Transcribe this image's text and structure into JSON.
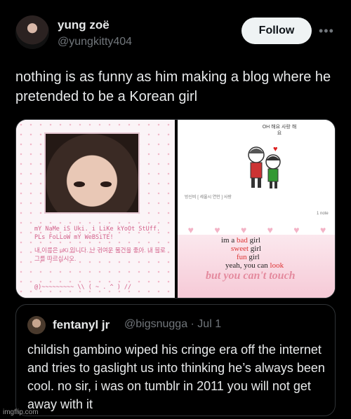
{
  "author": {
    "display_name": "yung zoë",
    "handle": "@yungkitty404",
    "follow_label": "Follow",
    "more_icon": "more-horizontal-icon"
  },
  "tweet": {
    "text": "nothing is as funny as him making a blog where he pretended to be a Korean girl"
  },
  "media": {
    "left_panel": {
      "bio_en": "mY NaMe iS Uki. i LiKe kYoOt StUff. PLs FoLLoW mY WeBSiTE!",
      "bio_ko": "내 이름은 uKi 입니다. 난 귀여운 물건을 좋아. 내 블로그를 따르십시오.",
      "signature": "@)~~~~~~~~~ \\\\ ( ~ . ^ ) //"
    },
    "right_panel": {
      "caption": "OH 해요 사랑 해요",
      "meta": "방신비 [ 세울시 연인 ] 사랑",
      "count": "1 note",
      "lyrics": {
        "l1_a": "im a ",
        "l1_hl": "bad",
        "l1_b": " girl",
        "l2_hl": "sweet",
        "l2_b": " girl",
        "l3_hl": "fun",
        "l3_b": " girl",
        "l4_a": "yeah, you can ",
        "l4_hl": "look",
        "l5": "but you can't touch"
      }
    }
  },
  "quote": {
    "name": "fentanyl jr",
    "handle": "@bigsnugga · Jul 1",
    "text": "childish gambino wiped his cringe era off the internet and tries to gaslight us into thinking he’s always been cool. no sir, i was on tumblr in 2011 you will not get away with it"
  },
  "watermark": "imgflip.com"
}
